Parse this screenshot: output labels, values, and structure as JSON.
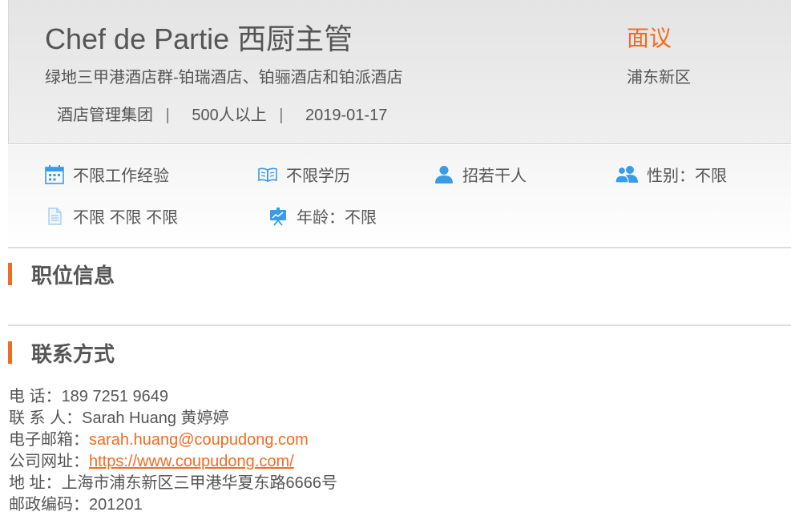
{
  "header": {
    "job_title": "Chef de Partie 西厨主管",
    "salary": "面议",
    "company": "绿地三甲港酒店群-铂瑞酒店、铂骊酒店和铂派酒店",
    "district": "浦东新区",
    "industry": "酒店管理集团",
    "company_size": "500人以上",
    "post_date": "2019-01-17",
    "separator": "|"
  },
  "attributes": {
    "experience": {
      "icon": "calendar-icon",
      "label": "不限工作经验"
    },
    "education": {
      "icon": "book-icon",
      "label": "不限学历"
    },
    "headcount": {
      "icon": "person-icon",
      "label": "招若干人"
    },
    "gender": {
      "icon": "people-icon",
      "label": "性别：不限"
    },
    "language": {
      "icon": "document-icon",
      "label": "不限 不限 不限"
    },
    "age": {
      "icon": "presentation-icon",
      "label": "年龄：不限"
    }
  },
  "sections": {
    "job_info": "职位信息",
    "contact": "联系方式"
  },
  "contact": {
    "phone_label": "电 话：",
    "phone": "189 7251 9649",
    "person_label": "联 系 人：",
    "person": "Sarah Huang 黄婷婷",
    "email_label": "电子邮箱：",
    "email": "sarah.huang@coupudong.com",
    "website_label": "公司网址：",
    "website": "https://www.coupudong.com/",
    "address_label": "地 址：",
    "address": "上海市浦东新区三甲港华夏东路6666号",
    "postcode_label": "邮政编码：",
    "postcode": "201201"
  },
  "colors": {
    "accent": "#f26b21",
    "icon_blue": "#3a9be8",
    "text": "#555555"
  }
}
